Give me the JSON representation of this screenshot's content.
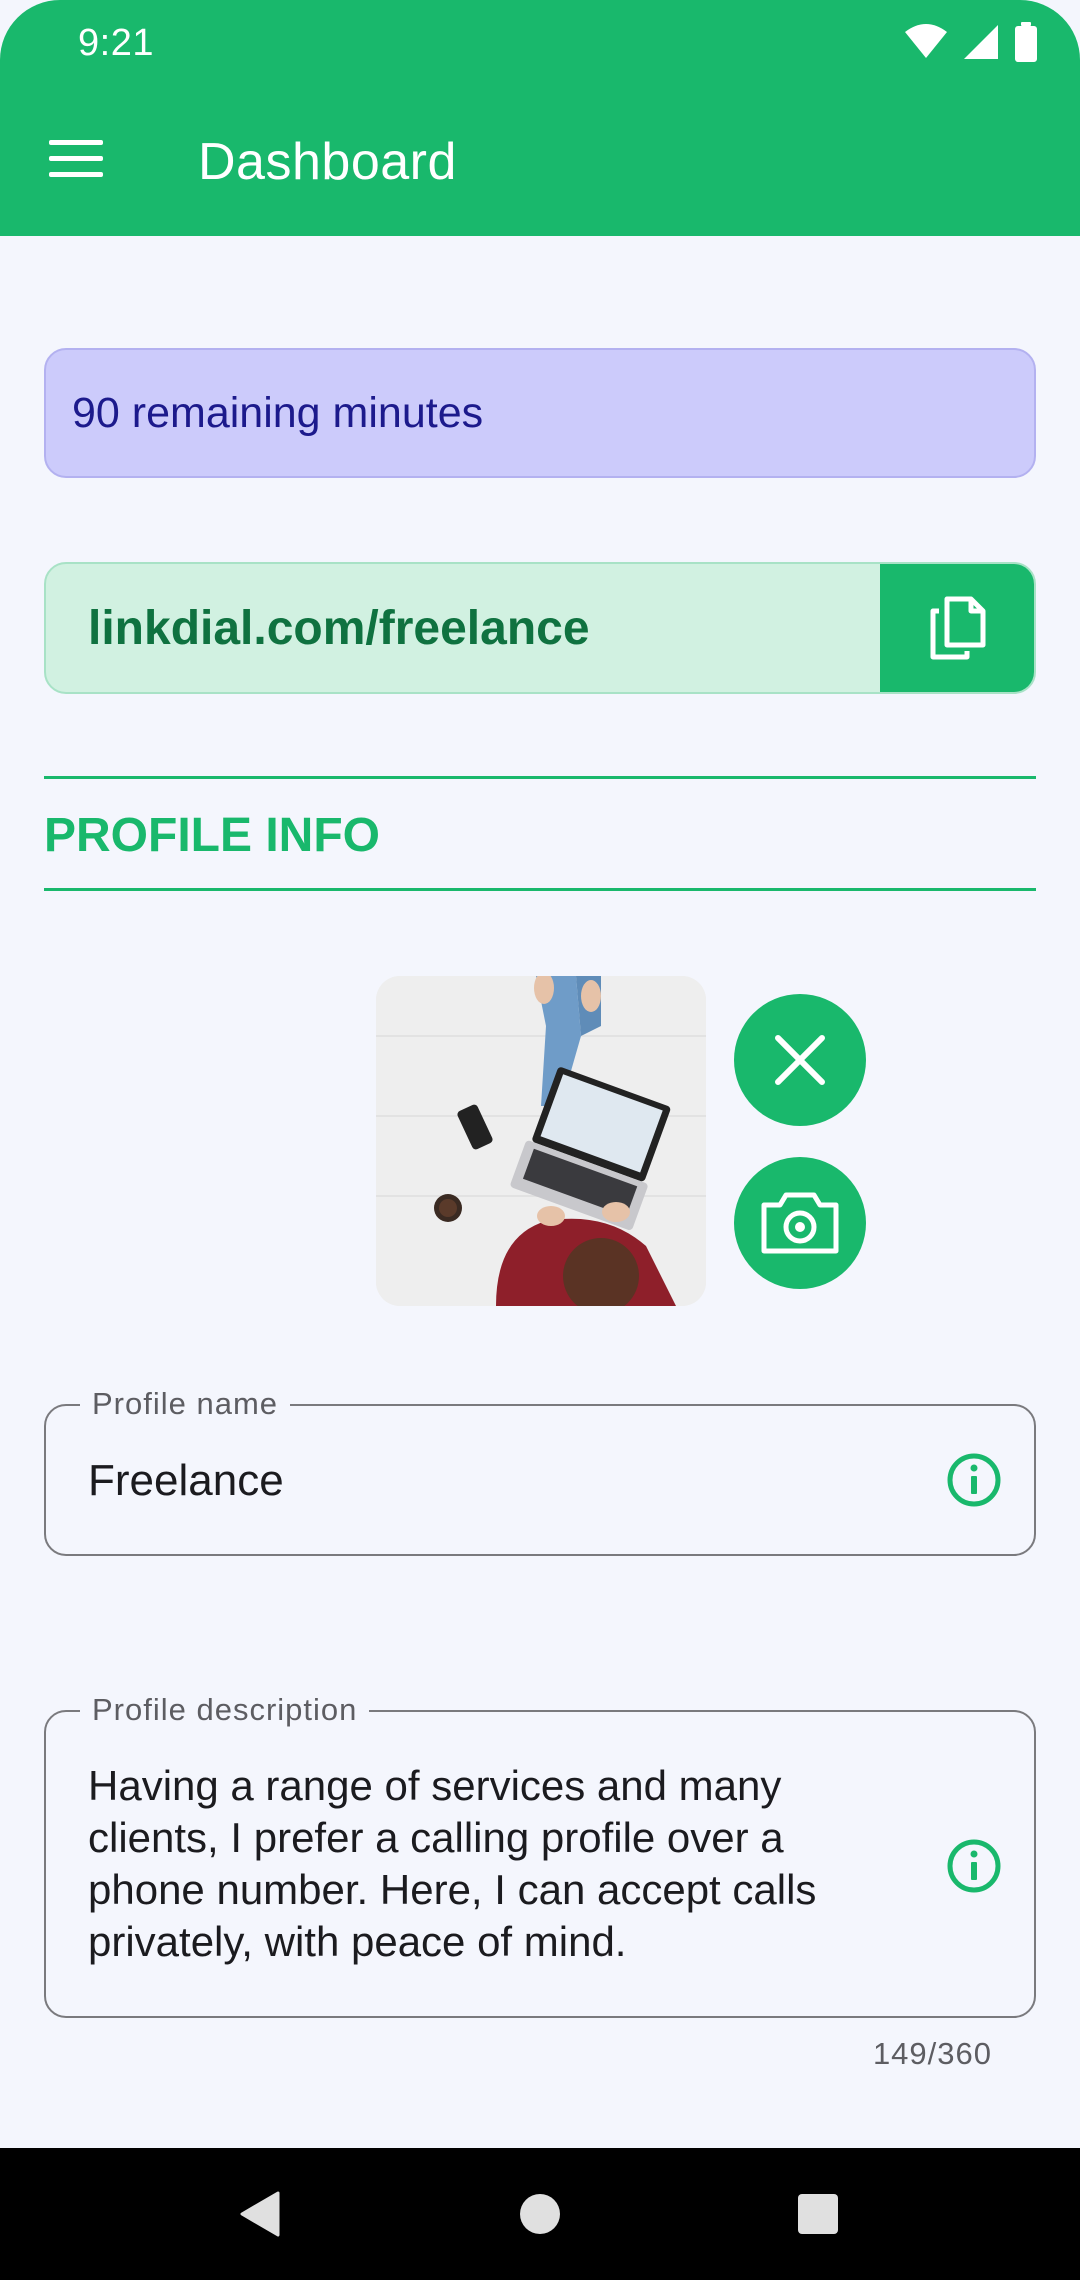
{
  "status_bar": {
    "time": "9:21",
    "icons": [
      "wifi-icon",
      "signal-icon",
      "battery-icon"
    ]
  },
  "app_bar": {
    "title": "Dashboard",
    "menu_icon": "menu-icon"
  },
  "minutes_banner": {
    "text": "90 remaining minutes"
  },
  "link": {
    "url": "linkdial.com/freelance",
    "copy_icon": "copy-icon"
  },
  "section": {
    "title": "PROFILE INFO"
  },
  "photo": {
    "remove_icon": "close-icon",
    "camera_icon": "camera-icon"
  },
  "profile_name": {
    "label": "Profile name",
    "value": "Freelance"
  },
  "profile_description": {
    "label": "Profile description",
    "lines": [
      "Having a range of services and many",
      "clients, I prefer a calling profile over a",
      "phone number. Here, I  can accept calls",
      "privately, with peace of mind."
    ],
    "counter": "149/360"
  },
  "colors": {
    "primary": "#19b86c",
    "banner_bg": "#cccbfb",
    "banner_text": "#1c1a8c",
    "link_bg": "#d1f1e1",
    "link_text": "#0f7240",
    "background": "#f4f6fd"
  },
  "nav_bar": {
    "items": [
      "back-icon",
      "home-icon",
      "recents-icon"
    ]
  }
}
